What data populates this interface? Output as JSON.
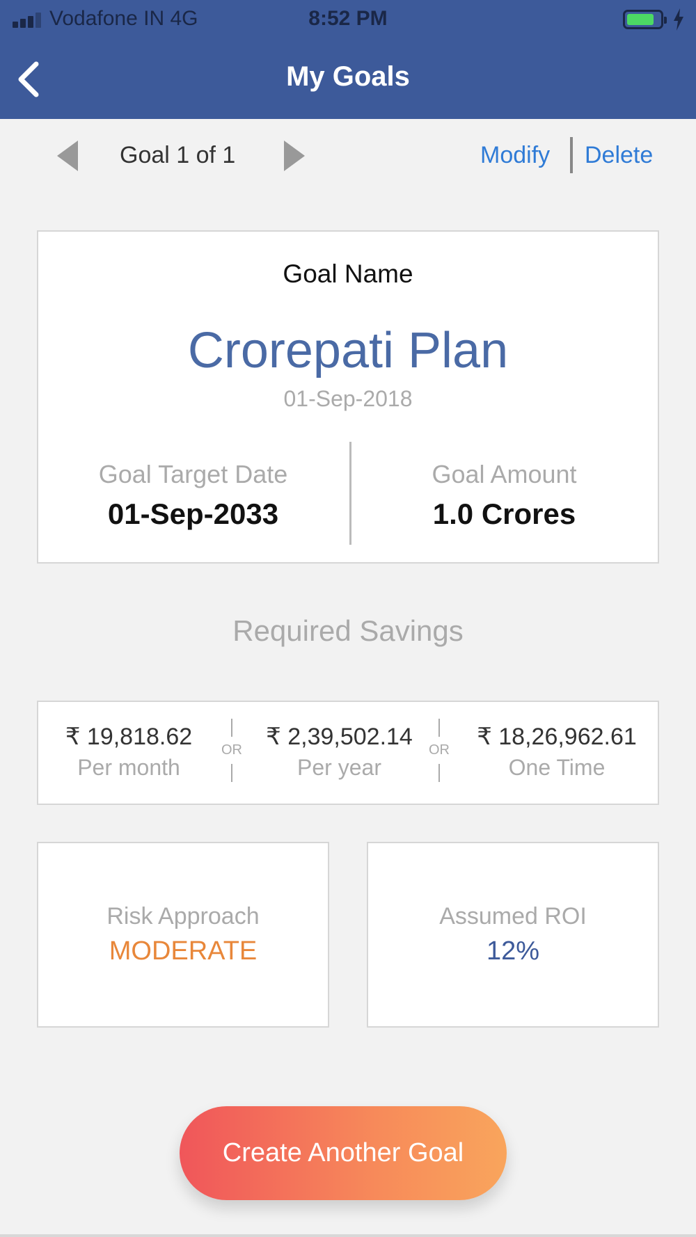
{
  "status_bar": {
    "carrier": "Vodafone IN   4G",
    "time": "8:52 PM",
    "battery_color": "#4cd964",
    "icons": [
      "signal-icon",
      "battery-icon",
      "charging-bolt-icon"
    ]
  },
  "header": {
    "title": "My Goals",
    "background": "#3d5a9a",
    "back_icon": "chevron-left-icon"
  },
  "pager": {
    "label": "Goal 1 of 1",
    "modify_label": "Modify",
    "delete_label": "Delete",
    "link_color": "#2f7bd6"
  },
  "goal": {
    "name_label": "Goal Name",
    "name": "Crorepati Plan",
    "start_date": "01-Sep-2018",
    "target_date_label": "Goal Target Date",
    "target_date": "01-Sep-2033",
    "amount_label": "Goal Amount",
    "amount": "1.0 Crores"
  },
  "savings": {
    "title": "Required Savings",
    "or_label": "OR",
    "options": [
      {
        "amount": "₹ 19,818.62",
        "period": "Per month"
      },
      {
        "amount": "₹ 2,39,502.14",
        "period": "Per year"
      },
      {
        "amount": "₹ 18,26,962.61",
        "period": "One Time"
      }
    ]
  },
  "risk": {
    "label": "Risk Approach",
    "value": "MODERATE",
    "color": "#e8873a"
  },
  "roi": {
    "label": "Assumed ROI",
    "value": "12%",
    "color": "#3d5a9a"
  },
  "cta": {
    "label": "Create Another Goal"
  }
}
